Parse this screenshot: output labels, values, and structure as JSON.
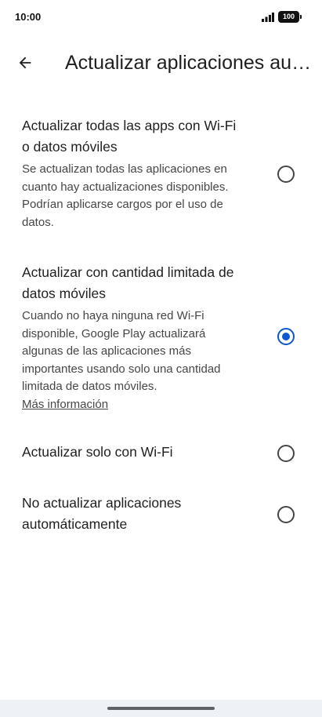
{
  "status_bar": {
    "time": "10:00",
    "battery": "100"
  },
  "app_bar": {
    "title": "Actualizar aplicaciones automáticamente"
  },
  "options": [
    {
      "title": "Actualizar todas las apps con Wi-Fi o datos móviles",
      "description": "Se actualizan todas las aplicaciones en cuanto hay actualizaciones disponibles. Podrían aplicarse cargos por el uso de datos.",
      "selected": false
    },
    {
      "title": "Actualizar con cantidad limitada de datos móviles",
      "description": "Cuando no haya ninguna red Wi-Fi disponible, Google Play actualizará algunas de las aplicaciones más importantes usando solo una cantidad limitada de datos móviles.",
      "link": "Más información",
      "selected": true
    },
    {
      "title": "Actualizar solo con Wi-Fi",
      "selected": false
    },
    {
      "title": "No actualizar aplicaciones automáticamente",
      "selected": false
    }
  ],
  "colors": {
    "accent": "#0b57d0",
    "text_primary": "#1f1f1f",
    "text_secondary": "#444746"
  }
}
